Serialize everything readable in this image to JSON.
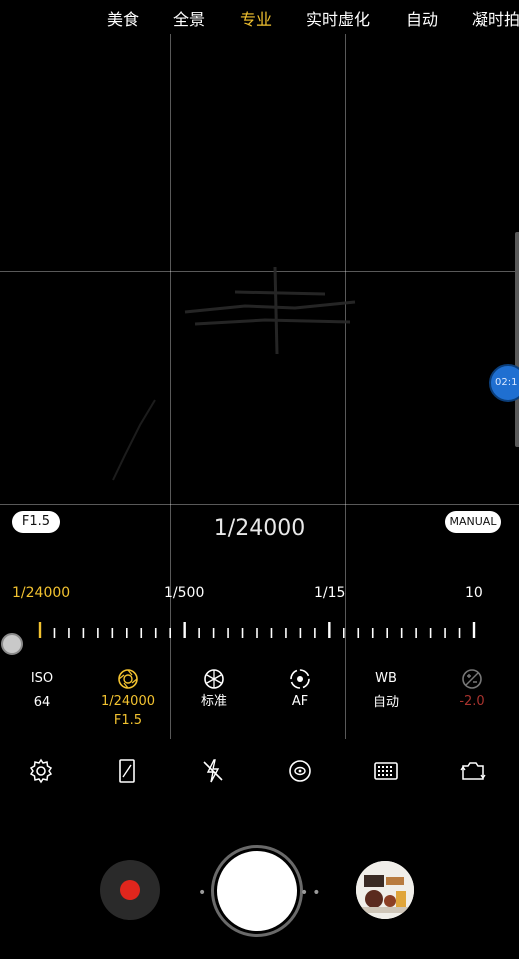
{
  "modes": [
    "美食",
    "全景",
    "专业",
    "实时虚化",
    "自动",
    "凝时拍"
  ],
  "active_mode": "专业",
  "timer_bubble": "02:1",
  "aperture_pill": "F1.5",
  "manual_pill": "MANUAL",
  "shutter_speed_readout": "1/24000",
  "scale": {
    "labels": [
      "1/24000",
      "1/500",
      "1/15",
      "10"
    ],
    "active_label": "1/24000"
  },
  "settings": [
    {
      "name": "ISO",
      "value": "64"
    },
    {
      "name": "1/24000",
      "value": "F1.5",
      "icon": "aperture-icon",
      "active": true
    },
    {
      "name": "标准",
      "icon": "color-tone-icon"
    },
    {
      "name": "AF",
      "icon": "focus-icon"
    },
    {
      "name": "WB",
      "value": "自动"
    },
    {
      "name": "-2.0",
      "icon": "exposure-icon",
      "dim": true
    }
  ],
  "toolbar_icons": [
    "settings-icon",
    "aspect-ratio-icon",
    "flash-off-icon",
    "hdr-icon",
    "grid-icon",
    "switch-camera-icon"
  ],
  "colors": {
    "accent": "#f2c230",
    "record": "#e0261d",
    "timer": "#1f6fd1",
    "exposure_dim": "#a8332e"
  }
}
